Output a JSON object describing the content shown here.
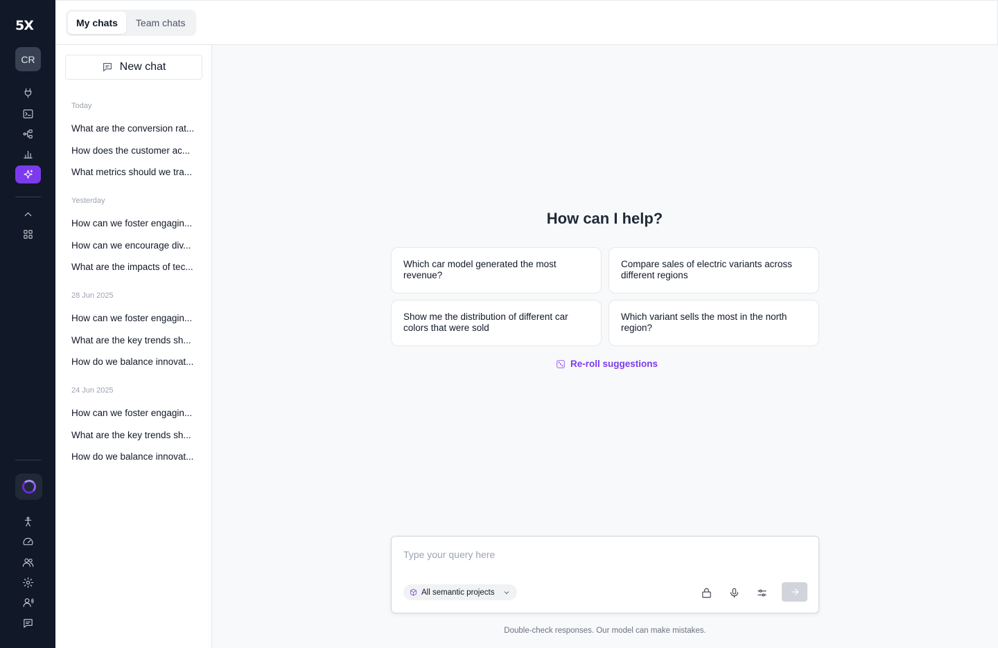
{
  "brand": {
    "logo_text": "5X",
    "avatar_initials": "CR"
  },
  "rail": {
    "top_icons": [
      "plug-icon",
      "terminal-icon",
      "workflow-icon",
      "bar-chart-icon",
      "sparkles-icon"
    ],
    "active": "sparkles-icon",
    "mid_icons": [
      "chevron-up-icon",
      "grid-icon"
    ],
    "bottom_icons": [
      "accessibility-icon",
      "gauge-icon",
      "users-icon",
      "settings-icon",
      "voice-user-icon",
      "message-icon"
    ],
    "accent": "#7c3aed"
  },
  "tabs": [
    {
      "label": "My chats",
      "active": true
    },
    {
      "label": "Team chats",
      "active": false
    }
  ],
  "sidebar": {
    "new_chat_label": "New chat",
    "groups": [
      {
        "label": "Today",
        "items": [
          "What are the conversion rat...",
          "How does the customer ac...",
          "What metrics should we tra..."
        ]
      },
      {
        "label": "Yesterday",
        "items": [
          "How can we foster engagin...",
          "How can we encourage div...",
          "What are the impacts of tec..."
        ]
      },
      {
        "label": "28 Jun 2025",
        "items": [
          "How can we foster engagin...",
          "What are the key trends sh...",
          "How do we balance innovat..."
        ]
      },
      {
        "label": "24 Jun 2025",
        "items": [
          "How can we foster engagin...",
          "What are the key trends sh...",
          "How do we balance innovat..."
        ]
      }
    ]
  },
  "main": {
    "heading": "How can I help?",
    "suggestions": [
      "Which car model generated the most revenue?",
      "Compare sales of electric variants across different regions",
      "Show me the distribution of different car colors that were sold",
      "Which variant sells the most in the north region?"
    ],
    "reroll_label": "Re-roll suggestions"
  },
  "composer": {
    "placeholder": "Type your query here",
    "value": "",
    "project_select": "All semantic projects"
  },
  "disclaimer": "Double-check responses. Our model can make mistakes."
}
